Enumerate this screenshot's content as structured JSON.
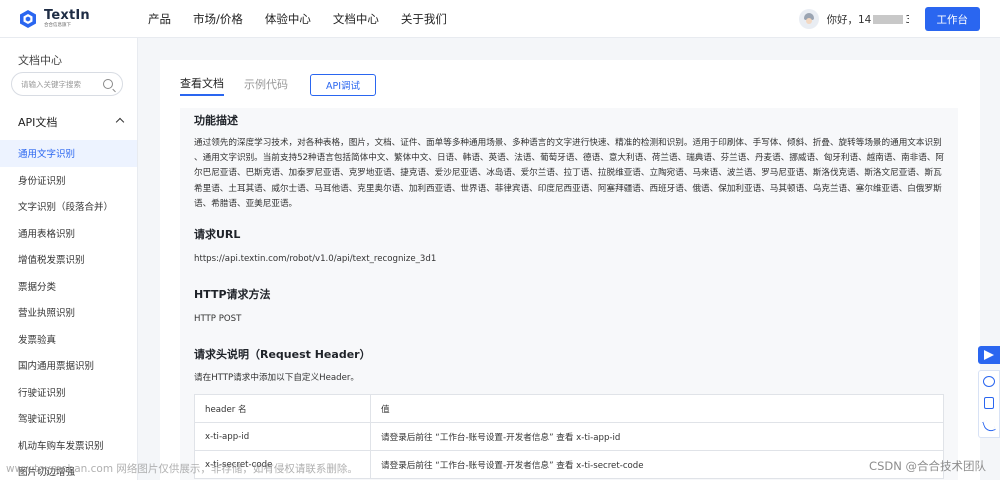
{
  "header": {
    "logo_title": "TextIn",
    "logo_subtitle": "合合信息旗下",
    "nav": [
      "产品",
      "市场/价格",
      "体验中心",
      "文档中心",
      "关于我们"
    ],
    "greeting_prefix": "你好，14",
    "greeting_suffix": "31",
    "workbench_button": "工作台"
  },
  "sidebar": {
    "title": "文档中心",
    "search_placeholder": "请输入关键字搜索",
    "section": "API文档",
    "items": [
      "通用文字识别",
      "身份证识别",
      "文字识别（段落合并）",
      "通用表格识别",
      "增值税发票识别",
      "票据分类",
      "营业执照识别",
      "发票验真",
      "国内通用票据识别",
      "行驶证识别",
      "驾驶证识别",
      "机动车购车发票识别",
      "图片切边增强"
    ],
    "active_index": 0
  },
  "main": {
    "tabs": [
      "查看文档",
      "示例代码"
    ],
    "tab_button": "API调试",
    "sections": {
      "func_title": "功能描述",
      "func_desc": "通过领先的深度学习技术，对各种表格，图片，文档、证件、面单等多种通用场景、多种语言的文字进行快速、精准的检测和识别。适用于印刷体、手写体、倾斜、折叠、旋转等场景的通用文本识别 、通用文字识别。当前支持52种语言包括简体中文、繁体中文、日语、韩语、英语、法语、葡萄牙语、德语、意大利语、荷兰语、瑞典语、芬兰语、丹麦语、挪威语、匈牙利语、越南语、南非语、阿尔巴尼亚语、巴斯克语、加泰罗尼亚语、克罗地亚语、捷克语、爱沙尼亚语、冰岛语、爱尔兰语、拉丁语、拉脱维亚语、立陶宛语、马来语、波兰语、罗马尼亚语、斯洛伐克语、斯洛文尼亚语、斯瓦希里语、土耳其语、威尔士语、马耳他语、克里奥尔语、加利西亚语、世界语、菲律宾语、印度尼西亚语、阿塞拜疆语、西班牙语、俄语、保加利亚语、马其顿语、乌克兰语、塞尔维亚语、白俄罗斯语、希腊语、亚美尼亚语。",
      "url_title": "请求URL",
      "url": "https://api.textin.com/robot/v1.0/api/text_recognize_3d1",
      "method_title": "HTTP请求方法",
      "method": "HTTP POST",
      "header_title": "请求头说明（Request Header）",
      "header_desc": "请在HTTP请求中添加以下自定义Header。"
    },
    "table": {
      "columns": [
        "header 名",
        "值"
      ],
      "rows": [
        [
          "x-ti-app-id",
          "请登录后前往 “工作台-账号设置-开发者信息” 查看 x-ti-app-id"
        ],
        [
          "x-ti-secret-code",
          "请登录后前往 “工作台-账号设置-开发者信息” 查看 x-ti-secret-code"
        ]
      ]
    }
  },
  "watermarks": {
    "left": "www.toymoban.com 网络图片仅供展示，非存储，如有侵权请联系删除。",
    "right": "CSDN @合合技术团队"
  },
  "colors": {
    "accent": "#2a66f0",
    "active_bg": "#edf3ff"
  },
  "icons": [
    "search-icon",
    "chevron-up-icon",
    "send-icon",
    "chat-icon",
    "edit-icon",
    "phone-icon"
  ]
}
